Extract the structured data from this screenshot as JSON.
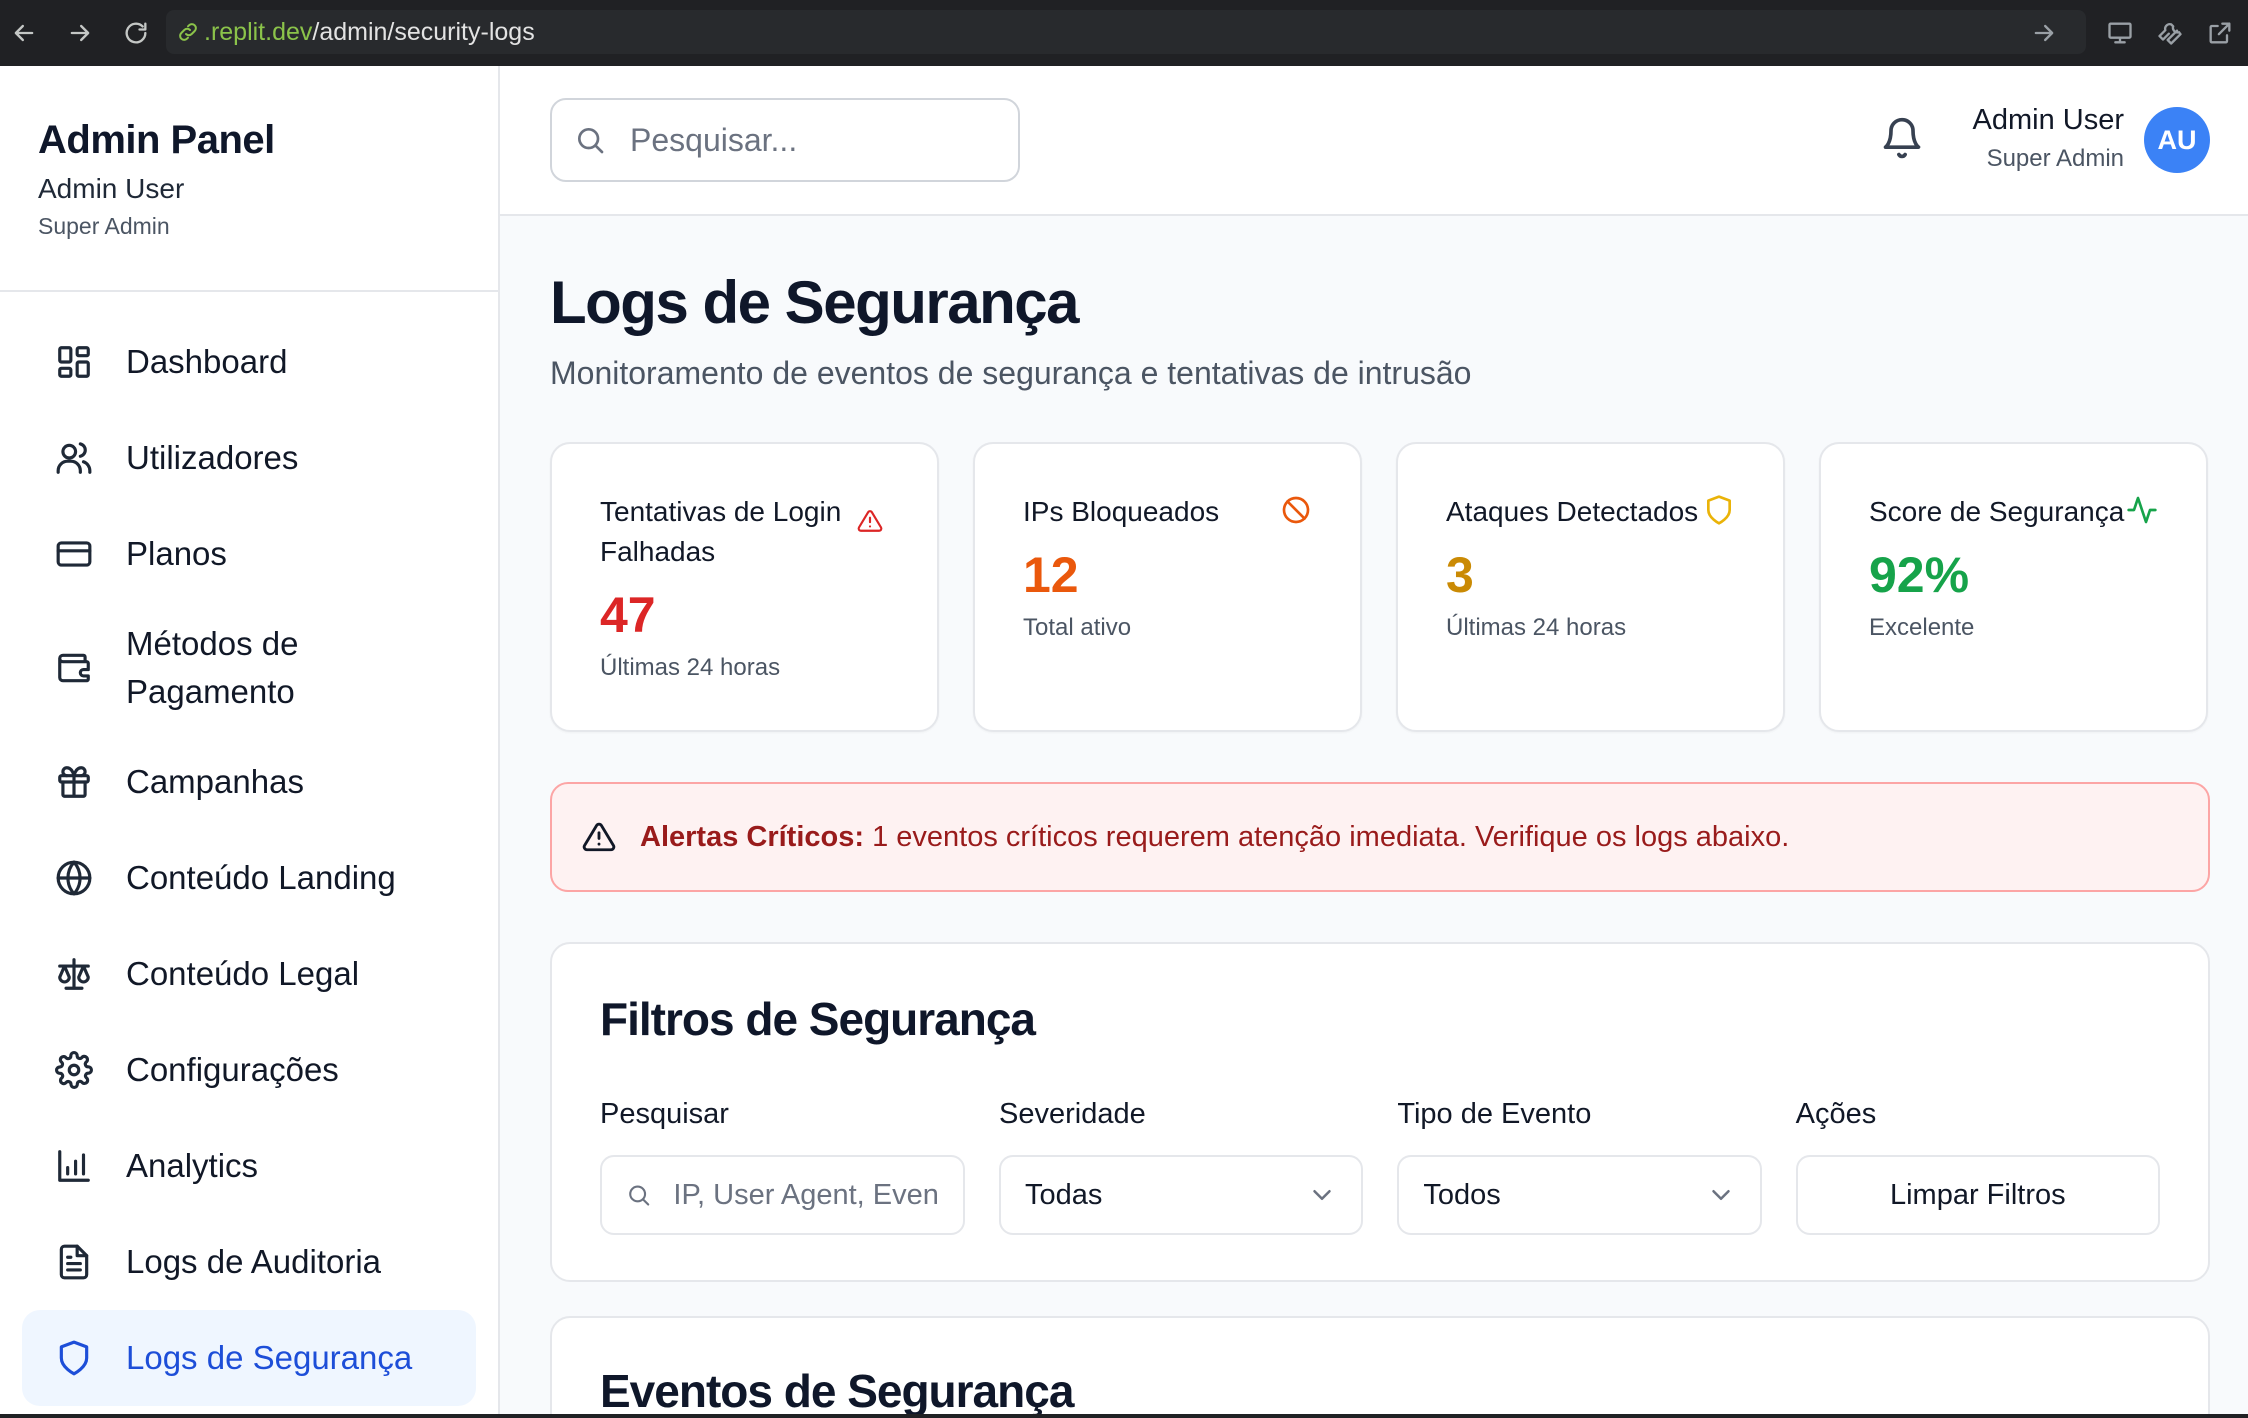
{
  "browser": {
    "url_host": ".replit.dev",
    "url_path": "/admin/security-logs"
  },
  "sidebar": {
    "title": "Admin Panel",
    "user": "Admin User",
    "role": "Super Admin",
    "items": [
      {
        "label": "Dashboard",
        "icon": "dashboard-icon"
      },
      {
        "label": "Utilizadores",
        "icon": "users-icon"
      },
      {
        "label": "Planos",
        "icon": "credit-card-icon"
      },
      {
        "label": "Métodos de Pagamento",
        "icon": "wallet-icon"
      },
      {
        "label": "Campanhas",
        "icon": "gift-icon"
      },
      {
        "label": "Conteúdo Landing",
        "icon": "globe-icon"
      },
      {
        "label": "Conteúdo Legal",
        "icon": "scale-icon"
      },
      {
        "label": "Configurações",
        "icon": "gear-icon"
      },
      {
        "label": "Analytics",
        "icon": "bar-chart-icon"
      },
      {
        "label": "Logs de Auditoria",
        "icon": "file-text-icon"
      },
      {
        "label": "Logs de Segurança",
        "icon": "shield-icon",
        "active": true
      }
    ]
  },
  "header": {
    "search_placeholder": "Pesquisar...",
    "user_name": "Admin User",
    "user_role": "Super Admin",
    "avatar_initials": "AU"
  },
  "page": {
    "title": "Logs de Segurança",
    "subtitle": "Monitoramento de eventos de segurança e tentativas de intrusão"
  },
  "stats": [
    {
      "title": "Tentativas de Login Falhadas",
      "value": "47",
      "note": "Últimas 24 horas",
      "color": "#dc2626",
      "icon": "alert-triangle-icon"
    },
    {
      "title": "IPs Bloqueados",
      "value": "12",
      "note": "Total ativo",
      "color": "#ea580c",
      "icon": "ban-icon"
    },
    {
      "title": "Ataques Detectados",
      "value": "3",
      "note": "Últimas 24 horas",
      "color": "#ca8a04",
      "icon": "shield-icon"
    },
    {
      "title": "Score de Segurança",
      "value": "92%",
      "note": "Excelente",
      "color": "#16a34a",
      "icon": "activity-icon"
    }
  ],
  "alert": {
    "label": "Alertas Críticos:",
    "message": " 1 eventos críticos requerem atenção imediata. Verifique os logs abaixo."
  },
  "filters": {
    "title": "Filtros de Segurança",
    "search_label": "Pesquisar",
    "search_placeholder": "IP, User Agent, Evento...",
    "severity_label": "Severidade",
    "severity_value": "Todas",
    "type_label": "Tipo de Evento",
    "type_value": "Todos",
    "actions_label": "Ações",
    "clear_button": "Limpar Filtros"
  },
  "events": {
    "title": "Eventos de Segurança"
  }
}
